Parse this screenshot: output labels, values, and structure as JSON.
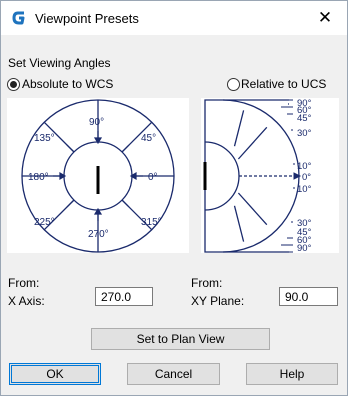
{
  "window": {
    "title": "Viewpoint Presets",
    "close_glyph": "✕",
    "icon": "G-app-icon",
    "icon_color": "#1e73be"
  },
  "group": {
    "label": "Set Viewing Angles"
  },
  "radios": [
    {
      "label": "Absolute to WCS",
      "checked": true
    },
    {
      "label": "Relative to UCS",
      "checked": false
    }
  ],
  "wcs_dial": {
    "angle_labels": [
      "90°",
      "45°",
      "0°",
      "315°",
      "270°",
      "225°",
      "180°",
      "135°"
    ]
  },
  "plane_dial": {
    "angle_labels": [
      "90°",
      "60°",
      "45°",
      "30°",
      "10°",
      "0°",
      "10°",
      "30°",
      "45°",
      "60°",
      "90°"
    ]
  },
  "fields": {
    "x_axis": {
      "label_top": "From:",
      "label": "X Axis:",
      "value": "270.0"
    },
    "xy_plane": {
      "label_top": "From:",
      "label": "XY Plane:",
      "value": "90.0"
    }
  },
  "buttons": {
    "plan_view": "Set to Plan View",
    "ok": "OK",
    "cancel": "Cancel",
    "help": "Help"
  }
}
